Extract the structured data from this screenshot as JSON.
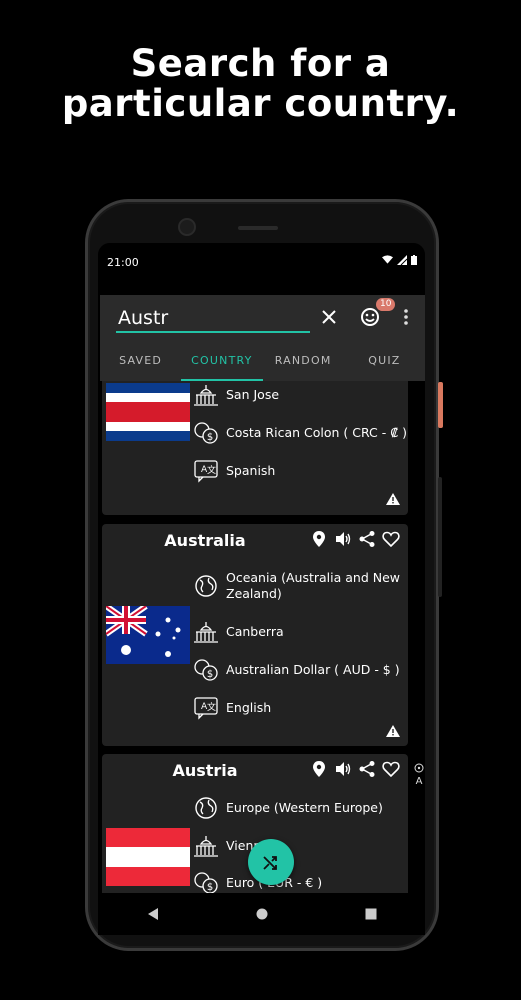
{
  "headline": {
    "line1": "Search for a",
    "line2": "particular country."
  },
  "status": {
    "time": "21:00"
  },
  "search": {
    "value": "Austr"
  },
  "badge_count": "10",
  "tabs": [
    {
      "label": "SAVED",
      "active": false
    },
    {
      "label": "COUNTRY",
      "active": true
    },
    {
      "label": "RANDOM",
      "active": false
    },
    {
      "label": "QUIZ",
      "active": false
    }
  ],
  "cards": [
    {
      "name": "",
      "capital": "San Jose",
      "currency": "Costa Rican Colon ( CRC - ₡ )",
      "language": "Spanish",
      "flag_icon": "costa-rica-flag"
    },
    {
      "name": "Australia",
      "region": "Oceania (Australia and New Zealand)",
      "capital": "Canberra",
      "currency": "Australian Dollar ( AUD - $ )",
      "language": "English",
      "flag_icon": "australia-flag"
    },
    {
      "name": "Austria",
      "region": "Europe (Western Europe)",
      "capital": "Vienna",
      "currency": "Euro ( EUR - € )",
      "flag_icon": "austria-flag"
    }
  ],
  "side_ctrl": {
    "letter": "A"
  },
  "colors": {
    "accent": "#22c3a6",
    "card_bg": "#222222",
    "badge": "#d9796b"
  }
}
